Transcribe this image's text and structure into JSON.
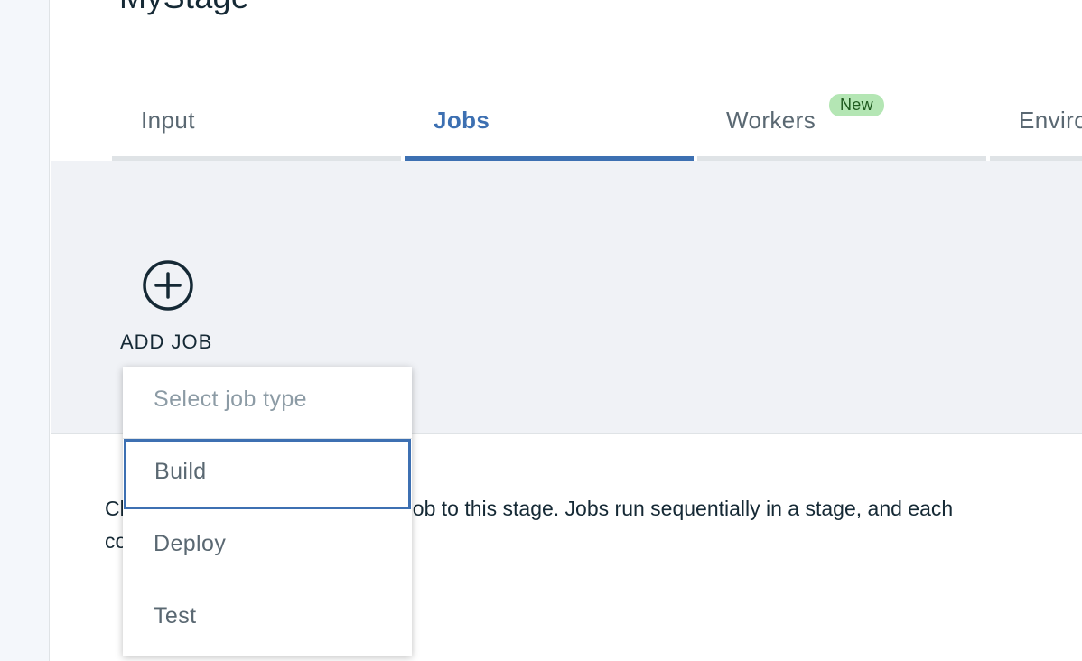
{
  "stage": {
    "title": "MyStage"
  },
  "tabs": [
    {
      "label": "Input",
      "active": false
    },
    {
      "label": "Jobs",
      "active": true
    },
    {
      "label": "Workers",
      "active": false,
      "badge": "New"
    },
    {
      "label": "Environment",
      "active": false
    }
  ],
  "add_job": {
    "label": "ADD JOB",
    "icon": "plus-circle-icon"
  },
  "description": {
    "visible_line_1_left": "Cl",
    "visible_line_1_right": "rst job to this stage. Jobs run sequentially in a stage, and each",
    "visible_line_2_left": "co"
  },
  "job_type_dropdown": {
    "placeholder": "Select job type",
    "options": [
      "Build",
      "Deploy",
      "Test"
    ],
    "focused_option": "Build"
  },
  "colors": {
    "accent": "#3d70b2",
    "badge_bg": "#b4e6b4",
    "gray_area": "#f0f2f6"
  }
}
